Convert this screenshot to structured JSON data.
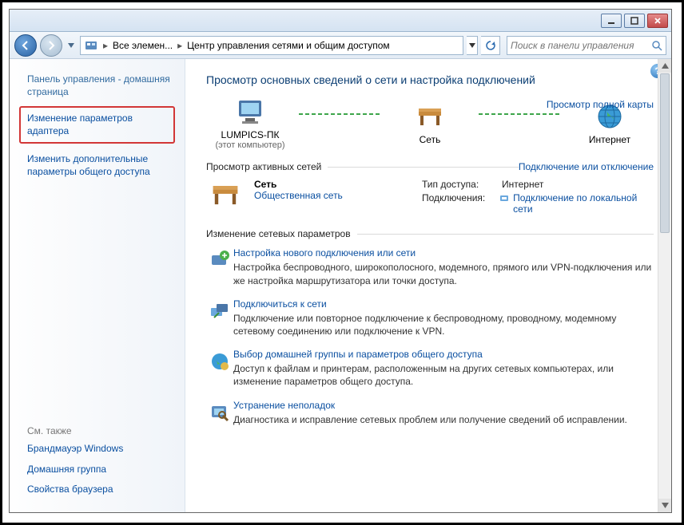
{
  "titlebar": {},
  "breadcrumb": {
    "seg1": "Все элемен...",
    "seg2": "Центр управления сетями и общим доступом"
  },
  "search": {
    "placeholder": "Поиск в панели управления"
  },
  "sidebar": {
    "home": "Панель управления - домашняя страница",
    "adapter": "Изменение параметров адаптера",
    "advanced": "Изменить дополнительные параметры общего доступа",
    "seealso": "См. также",
    "firewall": "Брандмауэр Windows",
    "homegroup": "Домашняя группа",
    "browser": "Свойства браузера"
  },
  "main": {
    "title": "Просмотр основных сведений о сети и настройка подключений",
    "fullmap": "Просмотр полной карты",
    "node_pc": "LUMPICS-ПК",
    "node_pc_sub": "(этот компьютер)",
    "node_net": "Сеть",
    "node_inet": "Интернет",
    "sect_active": "Просмотр активных сетей",
    "connect_toggle": "Подключение или отключение",
    "net_name": "Сеть",
    "net_type": "Общественная сеть",
    "k_access": "Тип доступа:",
    "v_access": "Интернет",
    "k_conn": "Подключения:",
    "v_conn": "Подключение по локальной сети",
    "sect_change": "Изменение сетевых параметров",
    "task1_t": "Настройка нового подключения или сети",
    "task1_d": "Настройка беспроводного, широкополосного, модемного, прямого или VPN-подключения или же настройка маршрутизатора или точки доступа.",
    "task2_t": "Подключиться к сети",
    "task2_d": "Подключение или повторное подключение к беспроводному, проводному, модемному сетевому соединению или подключение к VPN.",
    "task3_t": "Выбор домашней группы и параметров общего доступа",
    "task3_d": "Доступ к файлам и принтерам, расположенным на других сетевых компьютерах, или изменение параметров общего доступа.",
    "task4_t": "Устранение неполадок",
    "task4_d": "Диагностика и исправление сетевых проблем или получение сведений об исправлении."
  }
}
